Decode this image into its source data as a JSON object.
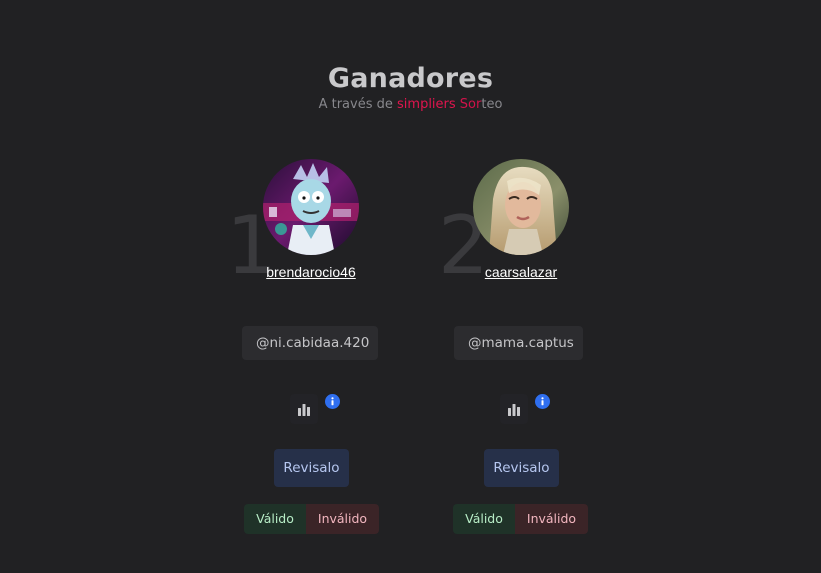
{
  "header": {
    "title": "Ganadores",
    "subtitle_prefix": "A través de ",
    "brand_part1": "simpliers",
    "brand_part2": " Sor",
    "brand_part3": "teo"
  },
  "winners": [
    {
      "rank": "1",
      "username": "brendarocio46",
      "handle": "@ni.cabidaa.420",
      "review_label": "Revisalo",
      "valid_label": "Válido",
      "invalid_label": "Inválido"
    },
    {
      "rank": "2",
      "username": "caarsalazar",
      "handle": "@mama.captus",
      "review_label": "Revisalo",
      "valid_label": "Válido",
      "invalid_label": "Inválido"
    }
  ],
  "icons": {
    "stats": "bar-chart-icon",
    "info": "info-icon"
  },
  "colors": {
    "background": "#212123",
    "brand": "#e0154e",
    "review_bg": "#263049",
    "valid_bg": "#1f3228",
    "invalid_bg": "#3b2427",
    "info": "#2f6ff0"
  }
}
